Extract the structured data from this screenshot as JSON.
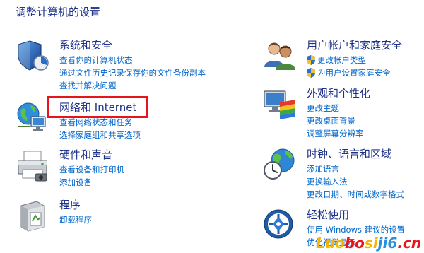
{
  "page": {
    "title": "调整计算机的设置"
  },
  "categories": {
    "system": {
      "title": "系统和安全",
      "links": [
        "查看你的计算机状态",
        "通过文件历史记录保存你的文件备份副本",
        "查找并解决问题"
      ],
      "icon": "security-shield-icon"
    },
    "network": {
      "title": "网络和 Internet",
      "links": [
        "查看网络状态和任务",
        "选择家庭组和共享选项"
      ],
      "icon": "network-globe-icon"
    },
    "hardware": {
      "title": "硬件和声音",
      "links": [
        "查看设备和打印机",
        "添加设备"
      ],
      "icon": "printer-icon"
    },
    "programs": {
      "title": "程序",
      "links": [
        "卸载程序"
      ],
      "icon": "programs-box-icon"
    },
    "users": {
      "title": "用户帐户和家庭安全",
      "links": [
        "更改帐户类型",
        "为用户设置家庭安全"
      ],
      "icon": "users-icon"
    },
    "appearance": {
      "title": "外观和个性化",
      "links": [
        "更改主题",
        "更改桌面背景",
        "调整屏幕分辨率"
      ],
      "icon": "monitor-palette-icon"
    },
    "clock": {
      "title": "时钟、语言和区域",
      "links": [
        "添加语言",
        "更换输入法",
        "更改日期、时间或数字格式"
      ],
      "icon": "clock-globe-icon"
    },
    "ease": {
      "title": "轻松使用",
      "links": [
        "使用 Windows 建议的设置",
        "优化视觉显示"
      ],
      "icon": "ease-of-access-icon"
    }
  },
  "watermark": {
    "part1": "Luo",
    "part2": "bo",
    "part3": "si",
    "part4": "ji6",
    "part5": ".cn"
  },
  "colors": {
    "heading": "#1e3287",
    "link": "#0066cc",
    "highlight": "#e8141b"
  }
}
